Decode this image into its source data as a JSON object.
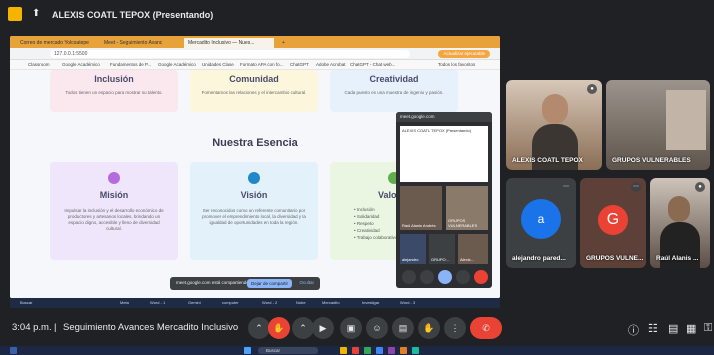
{
  "top_bar": {
    "presenter_title": "ALEXIS COATL TEPOX (Presentando)"
  },
  "browser": {
    "tabs": [
      "Correo de mercado Yolcoatepe",
      "Meet - Seguimiento Avanc",
      "Mercadito Inclusivo — Nues...",
      "+"
    ],
    "url": "127.0.0.1:5500",
    "cta": "Actualizar ejecutable",
    "bookmarks": [
      "Classroom",
      "Google Académico",
      "Fundamentos de P...",
      "Google Académico",
      "Unidades Clase",
      "Formato APA con fo...",
      "ChatGPT",
      "Adobe Acrobat",
      "ChatGPT - Chat web...",
      "Todos los favoritos"
    ]
  },
  "site": {
    "top_cards": [
      {
        "title": "Inclusión",
        "text": "Todos tienen un espacio para mostrar su talento."
      },
      {
        "title": "Comunidad",
        "text": "Fomentamos las relaciones y el intercambio cultural."
      },
      {
        "title": "Creatividad",
        "text": "Cada puesto es una muestra de ingenio y pasión."
      }
    ],
    "section_title": "Nuestra Esencia",
    "mission": {
      "title": "Misión",
      "text": "Impulsar la inclusión y el desarrollo económico de productores y artesanos locales, brindando un espacio digno, accesible y lleno de diversidad cultural."
    },
    "vision": {
      "title": "Visión",
      "text": "Ser reconocidos como un referente comunitario por promover el emprendimiento local, la diversidad y la igualdad de oportunidades en toda la región."
    },
    "values": {
      "title": "Valores",
      "items": [
        "Inclusión",
        "Solidaridad",
        "Respeto",
        "Creatividad",
        "Trabajo colaborativo"
      ]
    }
  },
  "share_bar": {
    "text": "meet.google.com está compartiendo la pantalla",
    "stop": "Dejar de compartir",
    "hide": "Ocultar"
  },
  "mini_meet": {
    "url": "meet.google.com",
    "presenter": "ALEXIS COATL TEPOX (Presentando)",
    "tiles": [
      "Raúl Alanis Andrés",
      "GRUPOS VULNERABLES",
      "alejandro",
      "GRUPO...",
      "Alexis..."
    ]
  },
  "taskbar_items": [
    "Buscar",
    "Meta",
    "Word - 1",
    "Gemini",
    "computer",
    "Word - 2",
    "Nube",
    "Mercadito",
    "Investigar",
    "Word - 3"
  ],
  "participants": [
    {
      "name": "ALEXIS COATL TEPOX",
      "initial": "",
      "color": "#8a6e55"
    },
    {
      "name": "GRUPOS VULNERABLES",
      "initial": "",
      "color": "#7a6b60"
    },
    {
      "name": "alejandro pared...",
      "initial": "a",
      "color": "#1a73e8"
    },
    {
      "name": "GRUPOS VULNE...",
      "initial": "G",
      "color": "#ea4335"
    },
    {
      "name": "Raúl Alanis ...",
      "initial": "",
      "color": "#5a4e46"
    }
  ],
  "meet_bar": {
    "time": "3:04 p.m.",
    "separator": "|",
    "title": "Seguimiento Avances Mercadito Inclusivo"
  },
  "windows_taskbar": {
    "search": "Buscar"
  },
  "colors": {
    "end_call": "#ea4335",
    "meet_bg": "#202124",
    "accent": "#8ab4f8"
  }
}
